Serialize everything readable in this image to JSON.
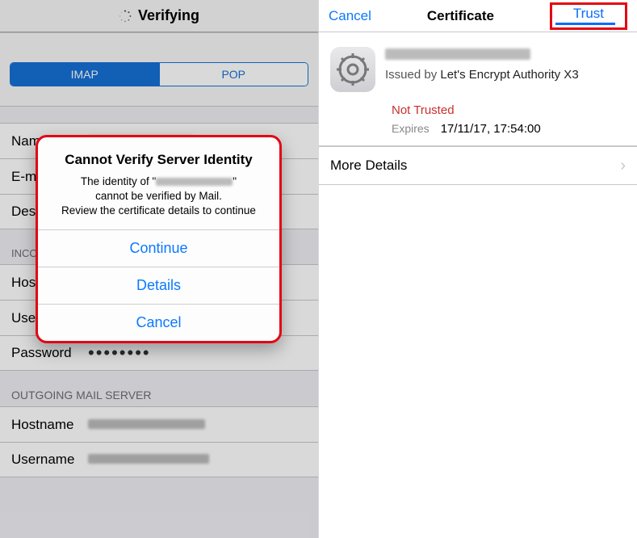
{
  "left": {
    "header_title": "Verifying",
    "segment": {
      "imap": "IMAP",
      "pop": "POP"
    },
    "fields": {
      "name_label": "Name",
      "email_label": "E-mail",
      "desc_label": "Description",
      "incoming_header": "INCOMING MAIL SERVER",
      "host_label": "Hostname",
      "user_label": "Username",
      "pass_label": "Password",
      "pass_value": "••••••••",
      "outgoing_header": "OUTGOING MAIL SERVER",
      "out_host_label": "Hostname",
      "out_user_label": "Username"
    }
  },
  "alert": {
    "title": "Cannot Verify Server Identity",
    "msg_line1_a": "The identity of \"",
    "msg_line1_b": "\"",
    "msg_line2": "cannot be verified by Mail.",
    "msg_line3": "Review the certificate details to continue",
    "continue": "Continue",
    "details": "Details",
    "cancel": "Cancel"
  },
  "right": {
    "cancel": "Cancel",
    "title": "Certificate",
    "trust": "Trust",
    "issued_prefix": "Issued by ",
    "issued_authority": "Let's Encrypt Authority X3",
    "status_label": "",
    "not_trusted": "Not Trusted",
    "expires_label": "Expires",
    "expires_value": "17/11/17, 17:54:00",
    "more_details": "More Details"
  }
}
